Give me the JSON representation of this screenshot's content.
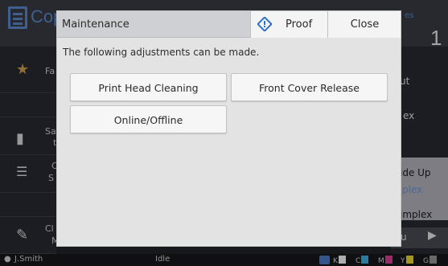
{
  "background": {
    "app_title": "Cop",
    "counter_label": "es",
    "counter_value": "1",
    "left_items": [
      {
        "label_a": "Fa",
        "label_b": ""
      },
      {
        "label_a": "Sa",
        "label_b": "t"
      },
      {
        "label_a": "C",
        "label_b": "S"
      },
      {
        "label_a": "Cl",
        "label_b": "M"
      }
    ],
    "right_items": [
      "ut",
      "ex",
      "ide Up",
      "plex",
      "implex",
      "u"
    ],
    "status": {
      "user": "J.Smith",
      "state": "Idle",
      "inks": [
        {
          "label": "K",
          "color": "#ffffff"
        },
        {
          "label": "C",
          "color": "#3fb6e6"
        },
        {
          "label": "M",
          "color": "#e0409a"
        },
        {
          "label": "Y",
          "color": "#f2df2a"
        },
        {
          "label": "G",
          "color": "#9a9a9a"
        }
      ]
    }
  },
  "dialog": {
    "title": "Maintenance",
    "proof_label": "Proof",
    "close_label": "Close",
    "description": "The following adjustments can be made.",
    "buttons": {
      "print_head_cleaning": "Print Head Cleaning",
      "front_cover_release": "Front Cover Release",
      "online_offline": "Online/Offline"
    }
  },
  "colors": {
    "accent": "#2f6fc8",
    "dialog_bg": "#e3e3e4"
  },
  "icons": {
    "proof": "proof-diamond-icon",
    "user": "user-icon",
    "status": "status-icon"
  }
}
